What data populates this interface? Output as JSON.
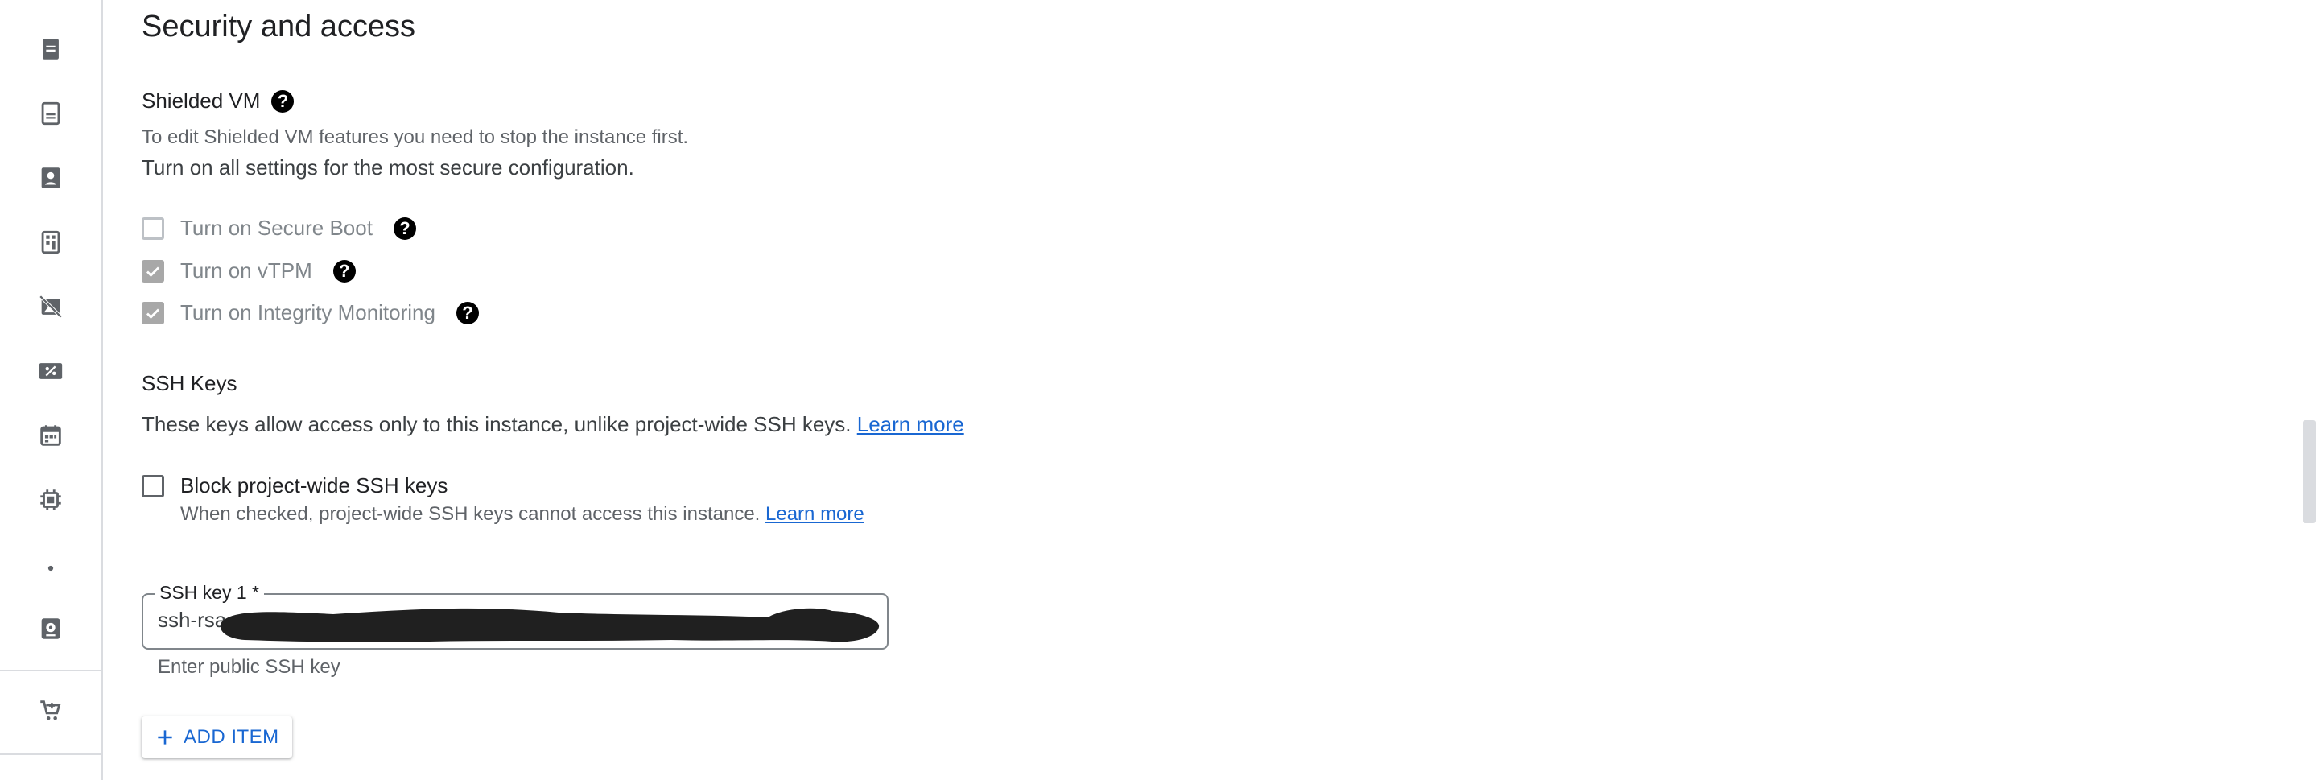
{
  "section": {
    "title": "Security and access"
  },
  "shielded_vm": {
    "title": "Shielded VM",
    "note": "To edit Shielded VM features you need to stop the instance first.",
    "recommendation": "Turn on all settings for the most secure configuration.",
    "options": [
      {
        "label": "Turn on Secure Boot",
        "checked": false,
        "disabled": true
      },
      {
        "label": "Turn on vTPM",
        "checked": true,
        "disabled": true
      },
      {
        "label": "Turn on Integrity Monitoring",
        "checked": true,
        "disabled": true
      }
    ]
  },
  "ssh_keys": {
    "title": "SSH Keys",
    "description": "These keys allow access only to this instance, unlike project-wide SSH keys.",
    "learn_more": "Learn more",
    "block_label": "Block project-wide SSH keys",
    "block_checked": false,
    "block_help": "When checked, project-wide SSH keys cannot access this instance.",
    "block_learn_more": "Learn more",
    "key_field": {
      "label": "SSH key 1 *",
      "value": "ssh-rsa",
      "hint": "Enter public SSH key"
    },
    "add_item_label": "ADD ITEM"
  },
  "colors": {
    "link": "#1967d2",
    "checkbox_checked_disabled": "#a8a8a8",
    "redaction": "#202020"
  },
  "icons": {
    "help": "help-circle-icon",
    "add": "plus-icon"
  }
}
